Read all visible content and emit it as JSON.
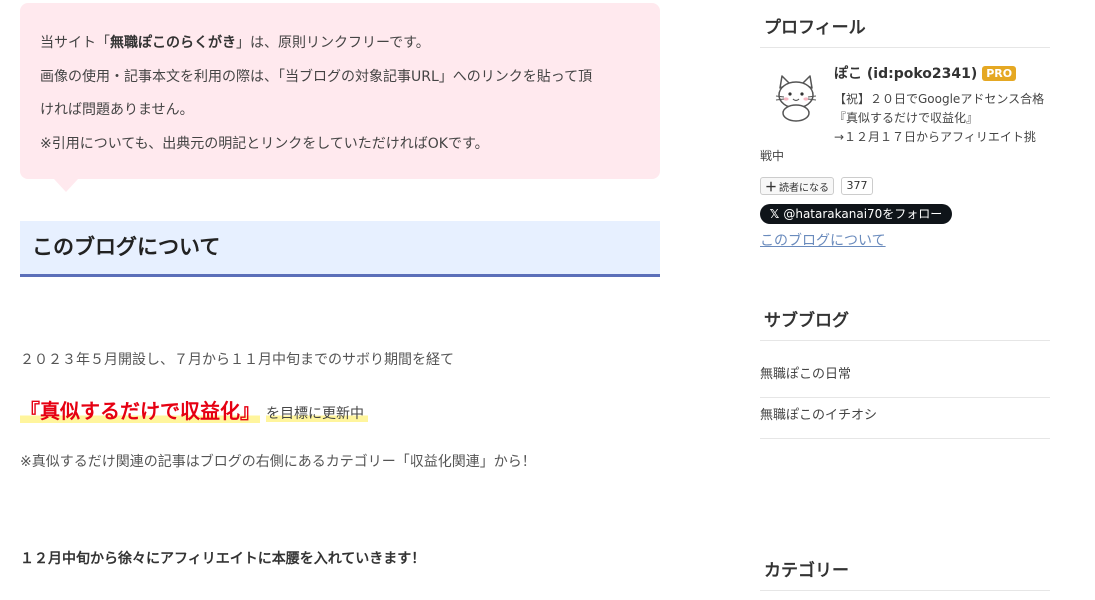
{
  "notice": {
    "line1_pre": "当サイト「",
    "line1_bold": "無職ぽこのらくがき",
    "line1_post": "」は、原則リンクフリーです。",
    "line2": "画像の使用・記事本文を利用の際は、「当ブログの対象記事URL」へのリンクを貼って頂",
    "line3": "ければ問題ありません。",
    "line4": "※引用についても、出典元の明記とリンクをしていただければOKです。"
  },
  "section": {
    "heading": "このブログについて"
  },
  "content": {
    "line1": "２０２３年５月開設し、７月から１１月中旬までのサボり期間を経て",
    "highlight_big": "『真似するだけで収益化』",
    "highlight_small": "を目標に更新中",
    "note": "※真似するだけ関連の記事はブログの右側にあるカテゴリー「収益化関連」から！",
    "bold_line": "１２月中旬から徐々にアフィリエイトに本腰を入れていきます！"
  },
  "sidebar": {
    "profile": {
      "heading": "プロフィール",
      "name": "ぽこ (id:poko2341)",
      "badge": "PRO",
      "desc_line1": "【祝】２０日でGoogleアドセンス合格",
      "desc_line2": "『真似するだけで収益化』",
      "desc_line3": "→１２月１７日からアフィリエイト挑",
      "desc_line4": "戦中",
      "reader_button": "読者になる",
      "reader_count": "377",
      "follow_button": "@hatarakanai70をフォロー",
      "about_link": "このブログについて"
    },
    "subblog": {
      "heading": "サブブログ",
      "items": [
        "無職ぽこの日常",
        "無職ぽこのイチオシ"
      ]
    },
    "category": {
      "heading": "カテゴリー"
    }
  },
  "colors": {
    "notice_bg": "#ffe9ee",
    "heading_bg": "#e7f0ff",
    "heading_border": "#5b6fb9",
    "highlight_red": "#e60012",
    "marker_yellow": "#fff59d",
    "badge_gold": "#e5a823",
    "link_blue": "#6a8bbd"
  }
}
